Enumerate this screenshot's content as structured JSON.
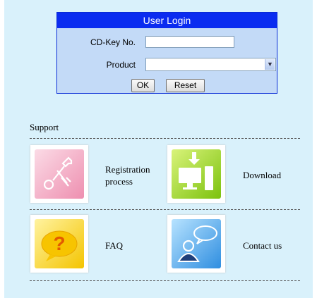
{
  "login": {
    "title": "User Login",
    "cdkey_label": "CD-Key No.",
    "cdkey_value": "",
    "product_label": "Product",
    "product_selected": "",
    "ok_label": "OK",
    "reset_label": "Reset"
  },
  "support": {
    "title": "Support",
    "items": [
      {
        "label_line1": "Registration",
        "label_line2": "process",
        "icon": "tools-icon"
      },
      {
        "label": "Download",
        "icon": "download-icon"
      },
      {
        "label": "FAQ",
        "icon": "question-icon"
      },
      {
        "label": "Contact us",
        "icon": "contact-icon"
      }
    ]
  },
  "colors": {
    "page_bg": "#d9f1fb",
    "login_header": "#0b2cf0",
    "login_body": "#c3daf7"
  }
}
